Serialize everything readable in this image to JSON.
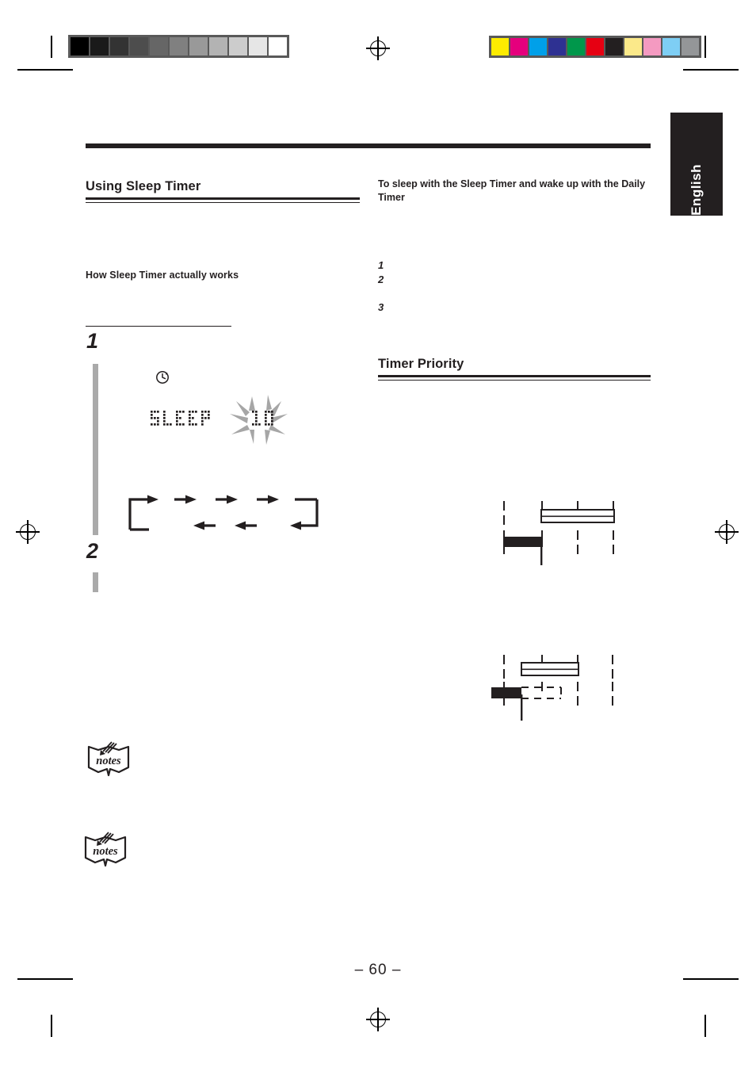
{
  "document": {
    "page_number_label": "– 60 –",
    "language_tab": "English"
  },
  "calibration": {
    "grayscale_label": "grayscale-calibration-bar",
    "grayscale_swatches": [
      "#000000",
      "#1a1a1a",
      "#333333",
      "#4d4d4d",
      "#666666",
      "#808080",
      "#999999",
      "#b3b3b3",
      "#cccccc",
      "#e6e6e6",
      "#ffffff"
    ],
    "color_label": "color-calibration-bar",
    "color_swatches": [
      "#fdec00",
      "#e5007d",
      "#00a0e9",
      "#2e3192",
      "#00974b",
      "#e60012",
      "#231f20",
      "#fbe98a",
      "#f49ac1",
      "#7ecef4",
      "#949698"
    ]
  },
  "left_column": {
    "section_title": "Using Sleep Timer",
    "subsection_title": "How Sleep Timer actually works",
    "steps": [
      {
        "number": "1"
      },
      {
        "number": "2"
      }
    ],
    "display": {
      "clock_icon": "clock-icon",
      "text": "SLEEP",
      "value": "10",
      "value_state": "flashing"
    },
    "sleep_cycle": {
      "caption": "sleep-timer-duration-cycle",
      "forward_arrows": 4,
      "reverse_arrows": 3
    },
    "notes_blocks": [
      {
        "label": "notes"
      },
      {
        "label": "notes"
      }
    ]
  },
  "right_column": {
    "intro_heading": "To sleep with the Sleep Timer and wake up with the Daily Timer",
    "ordered_items": [
      "1",
      "2",
      "3"
    ],
    "section_title": "Timer Priority",
    "diagrams": [
      {
        "name": "timer-priority-diagram-1",
        "tick_count": 4,
        "outline_bar": "daily-timer-span",
        "solid_bar": "sleep-timer-span",
        "marker": "shutoff-marker"
      },
      {
        "name": "timer-priority-diagram-2",
        "tick_count": 4,
        "outline_bar": "daily-timer-span",
        "solid_bar": "sleep-timer-span",
        "dashed_bar": "cancelled-span",
        "marker": "shutoff-marker"
      }
    ]
  }
}
